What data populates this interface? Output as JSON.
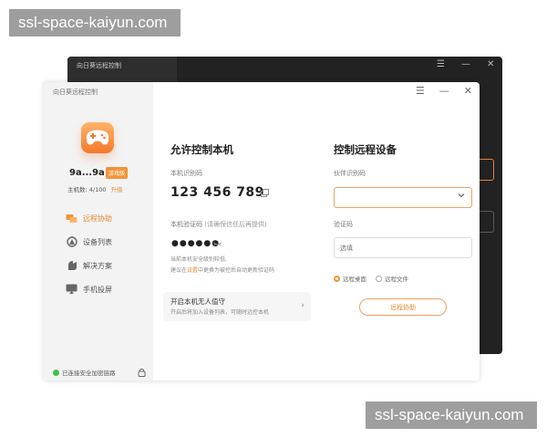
{
  "watermark": {
    "top": "ssl-space-kaiyun.com",
    "bottom": "ssl-space-kaiyun.com"
  },
  "back_window": {
    "title": "向日葵远程控制",
    "controls": [
      "☰",
      "—",
      "✕"
    ]
  },
  "window": {
    "title": "向日葵远程控制",
    "controls": {
      "menu": "☰",
      "minimize": "—",
      "close": "✕"
    }
  },
  "sidebar": {
    "username": "9a...9a",
    "tag": "游戏版",
    "machines_label": "主机数: 4/100",
    "upgrade_label": "升级",
    "nav": [
      {
        "label": "远程协助",
        "icon": "remote-assist-icon",
        "active": true
      },
      {
        "label": "设备列表",
        "icon": "device-list-icon",
        "active": false
      },
      {
        "label": "解决方案",
        "icon": "solution-icon",
        "active": false
      },
      {
        "label": "手机投屏",
        "icon": "screen-cast-icon",
        "active": false
      }
    ],
    "status": "已连接安全加密链路"
  },
  "allow_control": {
    "title": "允许控制本机",
    "id_label": "本机识别码",
    "id_value": "123 456 789",
    "code_label": "本机验证码",
    "code_note": "(请确保信任后再提供)",
    "code_value": "●●●●●●",
    "hint_line1": "当前本机安全级别较低,",
    "hint_line2_prefix": "建议在",
    "hint_link": "设置",
    "hint_line2_suffix": "中更换为被控后自动更新验证码",
    "card_title": "开启本机无人值守",
    "card_desc": "开启后将加入设备列表，可随时远控本机",
    "card_arrow": "›"
  },
  "remote_control": {
    "title": "控制远程设备",
    "partner_label": "伙伴识别码",
    "partner_value": "",
    "code_label": "验证码",
    "code_placeholder": "选填",
    "mode_desktop": "远程桌面",
    "mode_file": "远程文件",
    "connect_button": "远程协助"
  },
  "colors": {
    "accent": "#f19437",
    "status_green": "#3fbf4a",
    "back_window": "#222222"
  }
}
